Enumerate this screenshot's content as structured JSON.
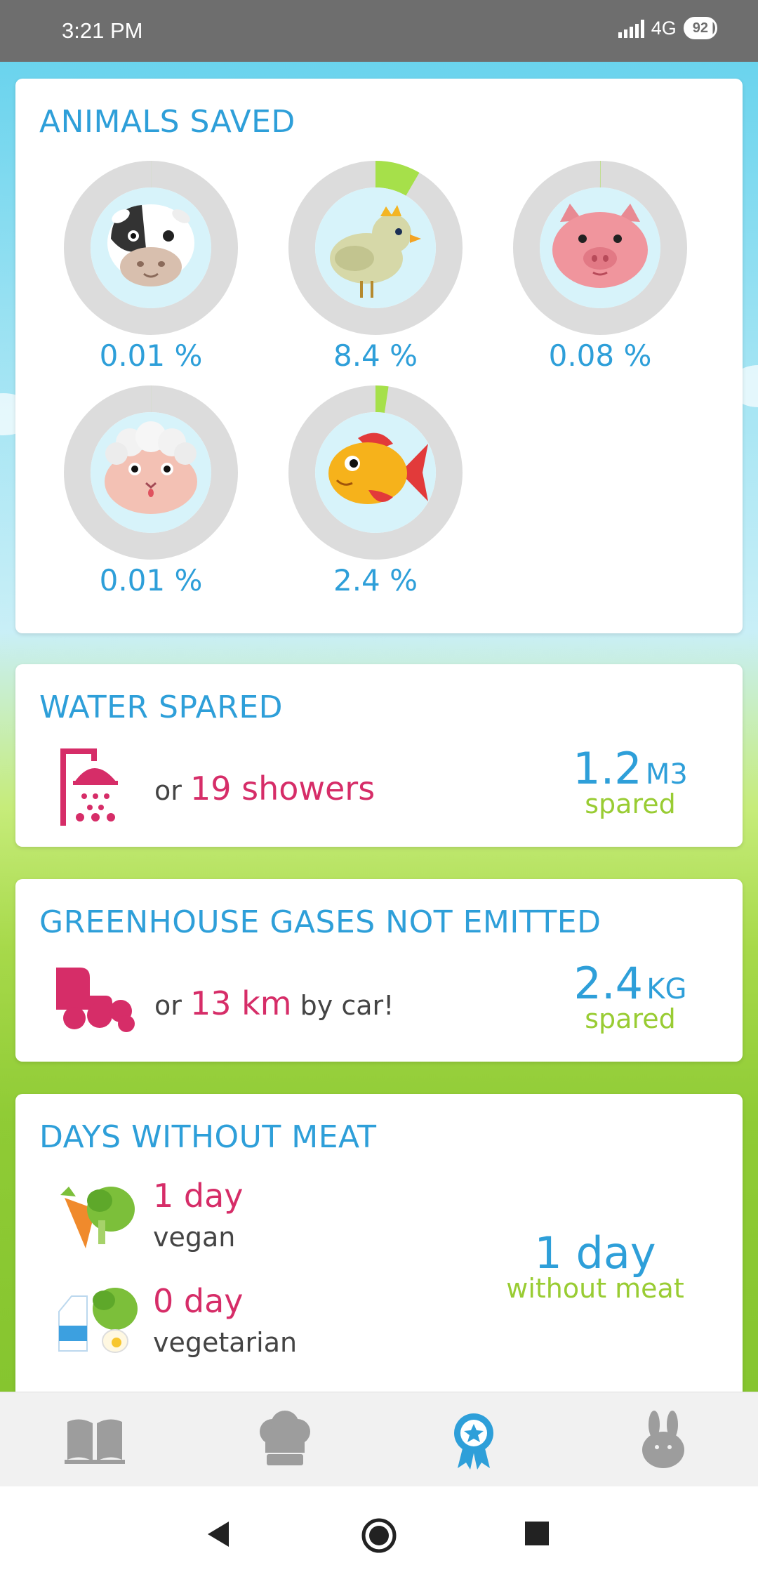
{
  "status_bar": {
    "time": "3:21 PM",
    "network": "4G",
    "battery": "92"
  },
  "animals_card": {
    "title": "ANIMALS SAVED",
    "animals": [
      {
        "name": "cow",
        "percent_label": "0.01 %",
        "progress": 0.0001
      },
      {
        "name": "chicken",
        "percent_label": "8.4 %",
        "progress": 0.084
      },
      {
        "name": "pig",
        "percent_label": "0.08 %",
        "progress": 0.0008
      },
      {
        "name": "sheep",
        "percent_label": "0.01 %",
        "progress": 0.0001
      },
      {
        "name": "fish",
        "percent_label": "2.4 %",
        "progress": 0.024
      }
    ]
  },
  "water_card": {
    "title": "WATER SPARED",
    "or_text": "or",
    "highlight": "19 showers",
    "value": "1.2",
    "unit": "M3",
    "sub": "spared"
  },
  "ghg_card": {
    "title": "GREENHOUSE GASES NOT EMITTED",
    "or_text": "or",
    "highlight": "13 km",
    "suffix": "by car!",
    "value": "2.4",
    "unit": "KG",
    "sub": "spared"
  },
  "days_card": {
    "title": "DAYS WITHOUT MEAT",
    "vegan_count": "1 day",
    "vegan_label": "vegan",
    "vegetarian_count": "0 day",
    "vegetarian_label": "vegetarian",
    "total": "1 day",
    "total_sub": "without meat"
  },
  "colors": {
    "primary": "#2e9fd9",
    "accent": "#d62d68",
    "green": "#99cc33",
    "ring_track": "#dcdcdc",
    "ring_fill": "#a6e04a"
  },
  "bottom_nav": [
    {
      "icon": "book-icon",
      "active": false
    },
    {
      "icon": "chef-hat-icon",
      "active": false
    },
    {
      "icon": "award-badge-icon",
      "active": true
    },
    {
      "icon": "rabbit-icon",
      "active": false
    }
  ]
}
